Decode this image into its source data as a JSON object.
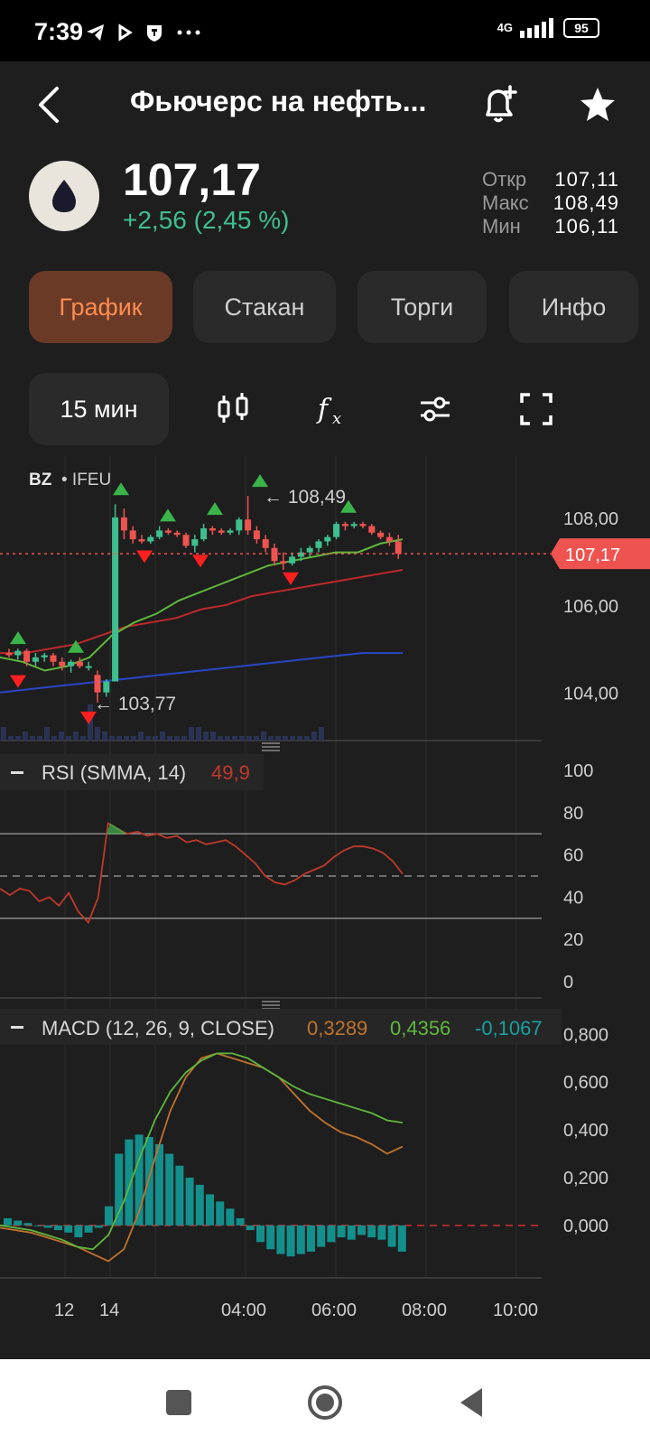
{
  "status": {
    "time": "7:39",
    "icons": [
      "telegram-icon",
      "play-icon",
      "shield-icon",
      "more-icon"
    ],
    "network": "4G",
    "battery": "95"
  },
  "header": {
    "title": "Фьючерс на нефть..."
  },
  "quote": {
    "price": "107,17",
    "change": "+2,56 (2,45 %)",
    "open_label": "Откр",
    "open": "107,11",
    "high_label": "Макс",
    "high": "108,49",
    "low_label": "Мин",
    "low": "106,11"
  },
  "tabs": [
    {
      "label": "График",
      "active": true
    },
    {
      "label": "Стакан",
      "active": false
    },
    {
      "label": "Торги",
      "active": false
    },
    {
      "label": "Инфо",
      "active": false
    }
  ],
  "toolbar": {
    "interval": "15 мин",
    "tools": [
      "candles-icon",
      "function-icon",
      "sliders-icon",
      "fullscreen-icon"
    ]
  },
  "colors": {
    "up": "#3fbf8f",
    "down": "#ef5350",
    "accent": "#ff8d4f",
    "accent_bg": "#6a3a27",
    "ma_green": "#5fb83c",
    "ma_red": "#c0282b",
    "ma_blue": "#2747c4",
    "macd_line": "#c1732c",
    "signal_line": "#5fb83c",
    "hist": "#138f8c",
    "rsi_line": "#c0392b"
  },
  "chart_data": [
    {
      "type": "candlestick",
      "symbol": "BZ",
      "exchange": "IFEU",
      "last_price_label": "107,17",
      "high_marker": "108,49",
      "low_marker": "103,77",
      "ylim": [
        102.9,
        109.4
      ],
      "y_ticks": [
        "108,00",
        "106,00",
        "104,00"
      ],
      "x_ticks": [
        "12",
        "14",
        "04:00",
        "06:00",
        "08:00",
        "10:00"
      ],
      "candles": [
        {
          "o": 104.9,
          "h": 105.0,
          "l": 104.8,
          "c": 104.85
        },
        {
          "o": 104.85,
          "h": 105.0,
          "l": 104.75,
          "c": 104.95
        },
        {
          "o": 104.95,
          "h": 105.0,
          "l": 104.6,
          "c": 104.7
        },
        {
          "o": 104.7,
          "h": 104.9,
          "l": 104.6,
          "c": 104.8
        },
        {
          "o": 104.8,
          "h": 104.9,
          "l": 104.7,
          "c": 104.85
        },
        {
          "o": 104.85,
          "h": 104.9,
          "l": 104.6,
          "c": 104.7
        },
        {
          "o": 104.7,
          "h": 104.8,
          "l": 104.5,
          "c": 104.6
        },
        {
          "o": 104.6,
          "h": 104.75,
          "l": 104.45,
          "c": 104.7
        },
        {
          "o": 104.7,
          "h": 104.8,
          "l": 104.55,
          "c": 104.6
        },
        {
          "o": 104.6,
          "h": 104.7,
          "l": 104.5,
          "c": 104.6
        },
        {
          "o": 104.4,
          "h": 104.5,
          "l": 103.77,
          "c": 104.0
        },
        {
          "o": 104.0,
          "h": 104.3,
          "l": 103.9,
          "c": 104.25
        },
        {
          "o": 104.25,
          "h": 108.3,
          "l": 106.0,
          "c": 108.0
        },
        {
          "o": 108.0,
          "h": 108.2,
          "l": 107.5,
          "c": 107.7
        },
        {
          "o": 107.7,
          "h": 107.8,
          "l": 107.4,
          "c": 107.5
        },
        {
          "o": 107.5,
          "h": 107.6,
          "l": 107.4,
          "c": 107.45
        },
        {
          "o": 107.45,
          "h": 107.6,
          "l": 107.4,
          "c": 107.55
        },
        {
          "o": 107.55,
          "h": 107.8,
          "l": 107.5,
          "c": 107.7
        },
        {
          "o": 107.7,
          "h": 107.75,
          "l": 107.6,
          "c": 107.65
        },
        {
          "o": 107.65,
          "h": 107.7,
          "l": 107.55,
          "c": 107.6
        },
        {
          "o": 107.6,
          "h": 107.65,
          "l": 107.3,
          "c": 107.35
        },
        {
          "o": 107.35,
          "h": 107.6,
          "l": 107.2,
          "c": 107.5
        },
        {
          "o": 107.5,
          "h": 107.85,
          "l": 107.45,
          "c": 107.75
        },
        {
          "o": 107.75,
          "h": 107.8,
          "l": 107.6,
          "c": 107.7
        },
        {
          "o": 107.7,
          "h": 107.75,
          "l": 107.6,
          "c": 107.65
        },
        {
          "o": 107.65,
          "h": 107.75,
          "l": 107.6,
          "c": 107.7
        },
        {
          "o": 107.7,
          "h": 108.0,
          "l": 107.6,
          "c": 107.95
        },
        {
          "o": 107.95,
          "h": 108.49,
          "l": 107.6,
          "c": 107.7
        },
        {
          "o": 107.7,
          "h": 107.8,
          "l": 107.4,
          "c": 107.5
        },
        {
          "o": 107.5,
          "h": 107.6,
          "l": 107.2,
          "c": 107.3
        },
        {
          "o": 107.3,
          "h": 107.4,
          "l": 106.9,
          "c": 107.0
        },
        {
          "o": 107.0,
          "h": 107.2,
          "l": 106.8,
          "c": 106.95
        },
        {
          "o": 106.95,
          "h": 107.2,
          "l": 106.9,
          "c": 107.1
        },
        {
          "o": 107.1,
          "h": 107.3,
          "l": 107.0,
          "c": 107.2
        },
        {
          "o": 107.2,
          "h": 107.35,
          "l": 107.1,
          "c": 107.3
        },
        {
          "o": 107.3,
          "h": 107.5,
          "l": 107.2,
          "c": 107.45
        },
        {
          "o": 107.45,
          "h": 107.6,
          "l": 107.35,
          "c": 107.55
        },
        {
          "o": 107.55,
          "h": 107.9,
          "l": 107.5,
          "c": 107.85
        },
        {
          "o": 107.85,
          "h": 107.9,
          "l": 107.7,
          "c": 107.8
        },
        {
          "o": 107.8,
          "h": 107.9,
          "l": 107.75,
          "c": 107.85
        },
        {
          "o": 107.85,
          "h": 107.9,
          "l": 107.75,
          "c": 107.8
        },
        {
          "o": 107.8,
          "h": 107.85,
          "l": 107.6,
          "c": 107.65
        },
        {
          "o": 107.65,
          "h": 107.7,
          "l": 107.5,
          "c": 107.55
        },
        {
          "o": 107.55,
          "h": 107.65,
          "l": 107.35,
          "c": 107.45
        },
        {
          "o": 107.45,
          "h": 107.6,
          "l": 107.05,
          "c": 107.17
        }
      ],
      "ma_fast": [
        104.8,
        104.7,
        104.5,
        104.6,
        104.8,
        105.3,
        105.6,
        105.8,
        106.1,
        106.3,
        106.5,
        106.7,
        106.9,
        107.0,
        107.1,
        107.2,
        107.2,
        107.4,
        107.5
      ],
      "ma_mid": [
        104.9,
        104.9,
        105.0,
        105.1,
        105.3,
        105.5,
        105.6,
        105.7,
        105.9,
        106.0,
        106.2,
        106.3,
        106.4,
        106.5,
        106.6,
        106.7,
        106.8
      ],
      "ma_slow": [
        104.0,
        104.1,
        104.2,
        104.3,
        104.4,
        104.5,
        104.6,
        104.7,
        104.8,
        104.9,
        104.9
      ],
      "volume": [
        3,
        1,
        1,
        2,
        1,
        1,
        3,
        1,
        2,
        1,
        2,
        1,
        8,
        3,
        2,
        1,
        1,
        1,
        1,
        2,
        1,
        1,
        2,
        1,
        1,
        1,
        3,
        3,
        2,
        2,
        1,
        1,
        1,
        1,
        1,
        1,
        2,
        1,
        1,
        1,
        1,
        1,
        1,
        2,
        3
      ]
    },
    {
      "type": "line",
      "name": "RSI (SMMA, 14)",
      "value": "49,9",
      "ylim": [
        0,
        100
      ],
      "y_ticks": [
        "100",
        "80",
        "60",
        "40",
        "20",
        "0"
      ],
      "levels": [
        70,
        50,
        30
      ],
      "values": [
        44,
        41,
        44,
        43,
        38,
        40,
        36,
        42,
        33,
        28,
        40,
        75,
        72,
        70,
        71,
        69,
        70,
        68,
        69,
        66,
        67,
        65,
        66,
        67,
        64,
        60,
        56,
        50,
        47,
        46,
        48,
        51,
        53,
        55,
        59,
        62,
        64,
        64,
        63,
        61,
        57,
        51
      ]
    },
    {
      "type": "bar+line",
      "name": "MACD (12, 26, 9, CLOSE)",
      "values": [
        "0,3289",
        "0,4356",
        "-0,1067"
      ],
      "ylim": [
        -0.22,
        0.82
      ],
      "y_ticks": [
        "0,800",
        "0,600",
        "0,400",
        "0,200",
        "0,000"
      ],
      "macd": [
        -0.01,
        -0.02,
        -0.03,
        -0.05,
        -0.07,
        -0.09,
        -0.12,
        -0.15,
        -0.1,
        0.06,
        0.28,
        0.48,
        0.62,
        0.7,
        0.72,
        0.7,
        0.68,
        0.66,
        0.62,
        0.55,
        0.48,
        0.43,
        0.39,
        0.37,
        0.34,
        0.3,
        0.33
      ],
      "signal": [
        0.0,
        -0.01,
        -0.02,
        -0.04,
        -0.06,
        -0.09,
        -0.1,
        -0.04,
        0.1,
        0.28,
        0.44,
        0.56,
        0.64,
        0.69,
        0.72,
        0.72,
        0.7,
        0.66,
        0.62,
        0.58,
        0.55,
        0.53,
        0.51,
        0.49,
        0.47,
        0.44,
        0.43
      ],
      "histogram": [
        0.03,
        0.02,
        0.01,
        0.0,
        -0.01,
        -0.02,
        -0.03,
        -0.05,
        -0.03,
        -0.01,
        0.08,
        0.3,
        0.36,
        0.38,
        0.37,
        0.34,
        0.3,
        0.25,
        0.2,
        0.17,
        0.13,
        0.1,
        0.07,
        0.03,
        -0.02,
        -0.07,
        -0.1,
        -0.12,
        -0.13,
        -0.12,
        -0.11,
        -0.09,
        -0.07,
        -0.05,
        -0.06,
        -0.04,
        -0.05,
        -0.06,
        -0.09,
        -0.11
      ]
    }
  ],
  "nav": {
    "buttons": [
      "recents-button",
      "home-button",
      "back-button"
    ]
  }
}
